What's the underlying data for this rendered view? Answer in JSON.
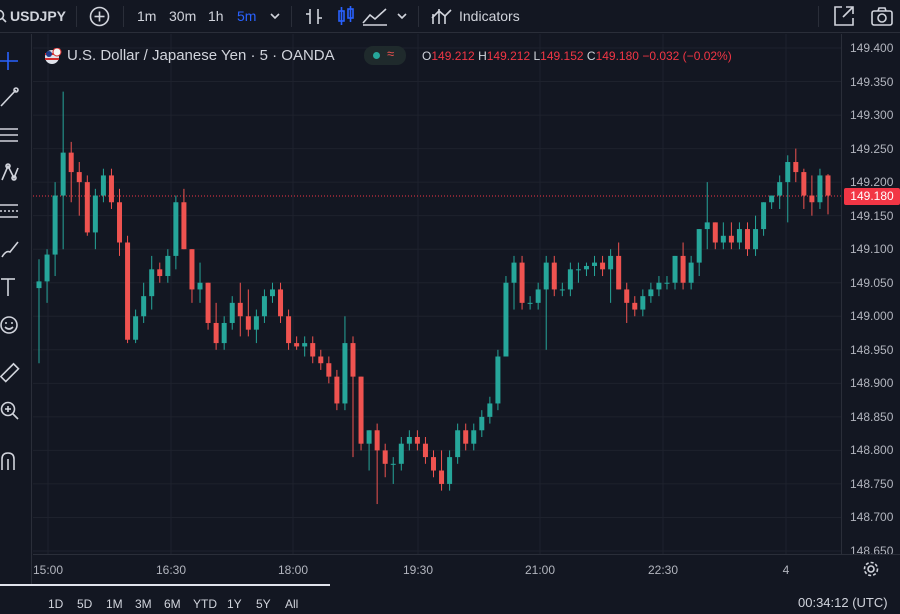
{
  "toolbar": {
    "symbol": "USDJPY",
    "intervals": [
      "1m",
      "30m",
      "1h",
      "5m"
    ],
    "active_interval": "5m",
    "indicators_label": "Indicators"
  },
  "legend": {
    "title": "U.S. Dollar / Japanese Yen · 5 · OANDA",
    "o_label": "O",
    "o_value": "149.212",
    "h_label": "H",
    "h_value": "149.212",
    "l_label": "L",
    "l_value": "149.152",
    "c_label": "C",
    "c_value": "149.180",
    "change": "−0.032 (−0.02%)"
  },
  "price_axis": {
    "labels": [
      "149.400",
      "149.350",
      "149.300",
      "149.250",
      "149.200",
      "149.150",
      "149.100",
      "149.050",
      "149.000",
      "148.950",
      "148.900",
      "148.850",
      "148.800",
      "148.750",
      "148.700",
      "148.650"
    ],
    "last_price": "149.180"
  },
  "time_axis": {
    "labels": [
      "15:00",
      "16:30",
      "18:00",
      "19:30",
      "21:00",
      "22:30",
      "4"
    ]
  },
  "bottom": {
    "ranges": [
      "1D",
      "5D",
      "1M",
      "3M",
      "6M",
      "YTD",
      "1Y",
      "5Y",
      "All"
    ],
    "clock": "00:34:12 (UTC)"
  },
  "colors": {
    "up": "#26a69a",
    "down": "#ef5350",
    "background": "#131722",
    "active": "#2962ff"
  },
  "chart_data": {
    "type": "candlestick",
    "ylim": [
      148.65,
      149.4
    ],
    "candles": [
      [
        149.042,
        149.085,
        148.93,
        149.052
      ],
      [
        149.052,
        149.1,
        149.02,
        149.092
      ],
      [
        149.092,
        149.2,
        149.06,
        149.18
      ],
      [
        149.18,
        149.335,
        149.1,
        149.244
      ],
      [
        149.244,
        149.26,
        149.17,
        149.215
      ],
      [
        149.215,
        149.23,
        149.15,
        149.2
      ],
      [
        149.2,
        149.21,
        149.12,
        149.125
      ],
      [
        149.125,
        149.19,
        149.1,
        149.18
      ],
      [
        149.18,
        149.22,
        149.17,
        149.21
      ],
      [
        149.21,
        149.22,
        149.16,
        149.17
      ],
      [
        149.17,
        149.19,
        149.09,
        149.11
      ],
      [
        149.11,
        149.12,
        148.96,
        148.965
      ],
      [
        148.965,
        149.01,
        148.96,
        149.0
      ],
      [
        149.0,
        149.05,
        148.99,
        149.03
      ],
      [
        149.03,
        149.09,
        149.01,
        149.07
      ],
      [
        149.07,
        149.08,
        149.05,
        149.06
      ],
      [
        149.06,
        149.1,
        149.05,
        149.09
      ],
      [
        149.09,
        149.18,
        149.07,
        149.17
      ],
      [
        149.17,
        149.19,
        149.1,
        149.1
      ],
      [
        149.1,
        149.1,
        149.02,
        149.04
      ],
      [
        149.04,
        149.08,
        149.02,
        149.05
      ],
      [
        149.05,
        149.05,
        148.98,
        148.99
      ],
      [
        148.99,
        149.02,
        148.95,
        148.96
      ],
      [
        148.96,
        149.0,
        148.95,
        148.99
      ],
      [
        148.99,
        149.03,
        148.98,
        149.02
      ],
      [
        149.02,
        149.05,
        148.97,
        149.0
      ],
      [
        149.0,
        149.04,
        148.97,
        148.98
      ],
      [
        148.98,
        149.01,
        148.96,
        149.0
      ],
      [
        149.0,
        149.04,
        148.99,
        149.03
      ],
      [
        149.03,
        149.05,
        149.02,
        149.04
      ],
      [
        149.04,
        149.05,
        148.99,
        149.0
      ],
      [
        149.0,
        149.01,
        148.95,
        148.96
      ],
      [
        148.96,
        148.97,
        148.95,
        148.955
      ],
      [
        148.955,
        148.97,
        148.94,
        148.96
      ],
      [
        148.96,
        148.97,
        148.93,
        148.94
      ],
      [
        148.94,
        148.95,
        148.92,
        148.93
      ],
      [
        148.93,
        148.94,
        148.9,
        148.91
      ],
      [
        148.91,
        148.92,
        148.86,
        148.87
      ],
      [
        148.87,
        149.0,
        148.86,
        148.96
      ],
      [
        148.96,
        148.97,
        148.79,
        148.91
      ],
      [
        148.91,
        148.91,
        148.8,
        148.81
      ],
      [
        148.81,
        148.83,
        148.77,
        148.83
      ],
      [
        148.83,
        148.84,
        148.72,
        148.8
      ],
      [
        148.8,
        148.81,
        148.76,
        148.78
      ],
      [
        148.78,
        148.79,
        148.75,
        148.78
      ],
      [
        148.78,
        148.82,
        148.77,
        148.81
      ],
      [
        148.81,
        148.83,
        148.8,
        148.82
      ],
      [
        148.82,
        148.83,
        148.8,
        148.81
      ],
      [
        148.81,
        148.82,
        148.78,
        148.79
      ],
      [
        148.79,
        148.8,
        148.76,
        148.77
      ],
      [
        148.77,
        148.8,
        148.74,
        148.75
      ],
      [
        148.75,
        148.8,
        148.74,
        148.79
      ],
      [
        148.79,
        148.84,
        148.78,
        148.83
      ],
      [
        148.83,
        148.84,
        148.8,
        148.81
      ],
      [
        148.81,
        148.84,
        148.8,
        148.83
      ],
      [
        148.83,
        148.86,
        148.82,
        148.85
      ],
      [
        148.85,
        148.88,
        148.84,
        148.87
      ],
      [
        148.87,
        148.95,
        148.86,
        148.94
      ],
      [
        148.94,
        149.06,
        148.94,
        149.05
      ],
      [
        149.05,
        149.09,
        149.01,
        149.08
      ],
      [
        149.08,
        149.09,
        149.01,
        149.02
      ],
      [
        149.02,
        149.03,
        149.01,
        149.02
      ],
      [
        149.02,
        149.05,
        149.01,
        149.04
      ],
      [
        149.04,
        149.09,
        148.95,
        149.08
      ],
      [
        149.08,
        149.09,
        149.03,
        149.04
      ],
      [
        149.04,
        149.05,
        149.03,
        149.04
      ],
      [
        149.04,
        149.08,
        149.03,
        149.07
      ],
      [
        149.07,
        149.08,
        149.05,
        149.07
      ],
      [
        149.07,
        149.08,
        149.06,
        149.075
      ],
      [
        149.075,
        149.09,
        149.06,
        149.08
      ],
      [
        149.08,
        149.09,
        149.06,
        149.07
      ],
      [
        149.07,
        149.1,
        149.02,
        149.09
      ],
      [
        149.09,
        149.11,
        149.04,
        149.04
      ],
      [
        149.04,
        149.05,
        148.99,
        149.02
      ],
      [
        149.02,
        149.03,
        149.0,
        149.01
      ],
      [
        149.01,
        149.04,
        149.0,
        149.03
      ],
      [
        149.03,
        149.05,
        149.02,
        149.04
      ],
      [
        149.04,
        149.06,
        149.03,
        149.05
      ],
      [
        149.05,
        149.06,
        149.04,
        149.05
      ],
      [
        149.05,
        149.09,
        149.04,
        149.09
      ],
      [
        149.09,
        149.11,
        149.04,
        149.05
      ],
      [
        149.05,
        149.09,
        149.04,
        149.08
      ],
      [
        149.08,
        149.13,
        149.06,
        149.13
      ],
      [
        149.13,
        149.2,
        149.1,
        149.14
      ],
      [
        149.14,
        149.14,
        149.1,
        149.11
      ],
      [
        149.11,
        149.14,
        149.1,
        149.12
      ],
      [
        149.12,
        149.14,
        149.1,
        149.11
      ],
      [
        149.11,
        149.14,
        149.1,
        149.13
      ],
      [
        149.13,
        149.14,
        149.09,
        149.1
      ],
      [
        149.1,
        149.15,
        149.09,
        149.13
      ],
      [
        149.13,
        149.17,
        149.12,
        149.17
      ],
      [
        149.17,
        149.18,
        149.16,
        149.18
      ],
      [
        149.18,
        149.21,
        149.16,
        149.2
      ],
      [
        149.2,
        149.24,
        149.14,
        149.23
      ],
      [
        149.23,
        149.25,
        149.2,
        149.215
      ],
      [
        149.215,
        149.22,
        149.16,
        149.18
      ],
      [
        149.18,
        149.21,
        149.15,
        149.17
      ],
      [
        149.17,
        149.22,
        149.16,
        149.21
      ],
      [
        149.21,
        149.212,
        149.152,
        149.18
      ]
    ]
  }
}
